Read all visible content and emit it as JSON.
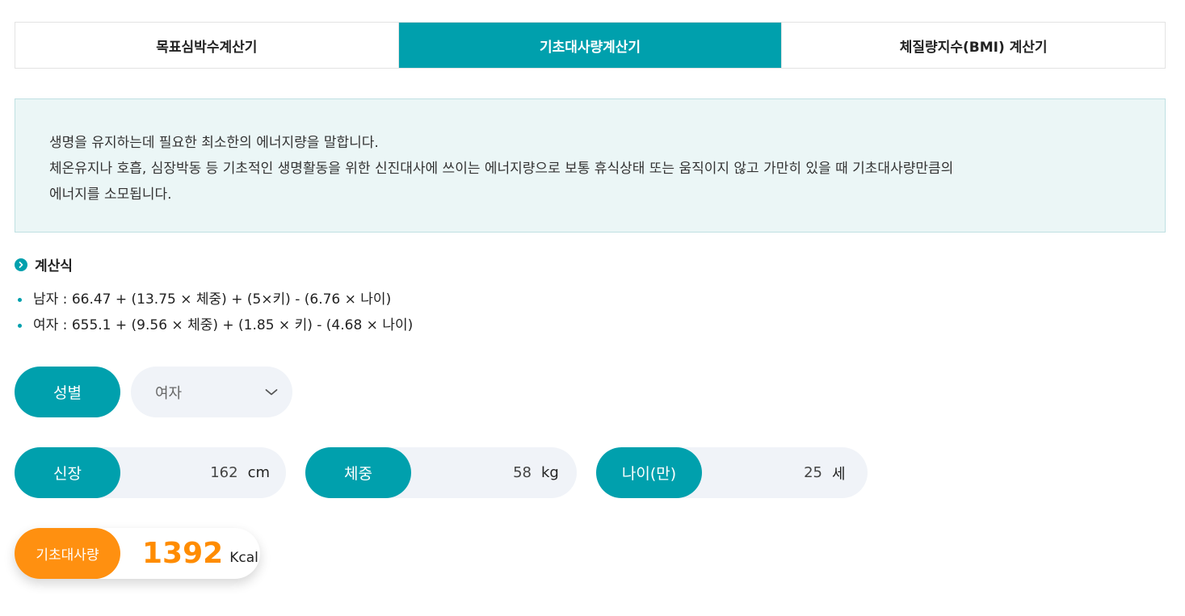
{
  "tabs": [
    {
      "label": "목표심박수계산기",
      "active": false
    },
    {
      "label": "기초대사량계산기",
      "active": true
    },
    {
      "label": "체질량지수(BMI) 계산기",
      "active": false
    }
  ],
  "info": {
    "line1": "생명을 유지하는데 필요한 최소한의 에너지량을 말합니다.",
    "line2": "체온유지나 호흡, 심장박동 등 기초적인 생명활동을 위한 신진대사에 쓰이는 에너지량으로 보통 휴식상태 또는 움직이지 않고 가만히 있을 때 기초대사량만큼의",
    "line3": "에너지를 소모됩니다."
  },
  "formula": {
    "title": "계산식",
    "male": "남자 : 66.47 + (13.75 × 체중) + (5×키) - (6.76 × 나이)",
    "female": "여자 : 655.1 + (9.56 × 체중) + (1.85 × 키) - (4.68 × 나이)"
  },
  "gender": {
    "label": "성별",
    "selected": "여자"
  },
  "height": {
    "label": "신장",
    "value": "162",
    "unit": "cm"
  },
  "weight": {
    "label": "체중",
    "value": "58",
    "unit": "kg"
  },
  "age": {
    "label": "나이(만)",
    "value": "25",
    "unit": "세"
  },
  "result": {
    "label": "기초대사량",
    "value": "1392",
    "unit": "Kcal"
  },
  "colors": {
    "accent": "#00a0ad",
    "result_accent": "#ff9010",
    "info_bg": "#ebf6f6",
    "field_bg": "#f0f3f8"
  }
}
